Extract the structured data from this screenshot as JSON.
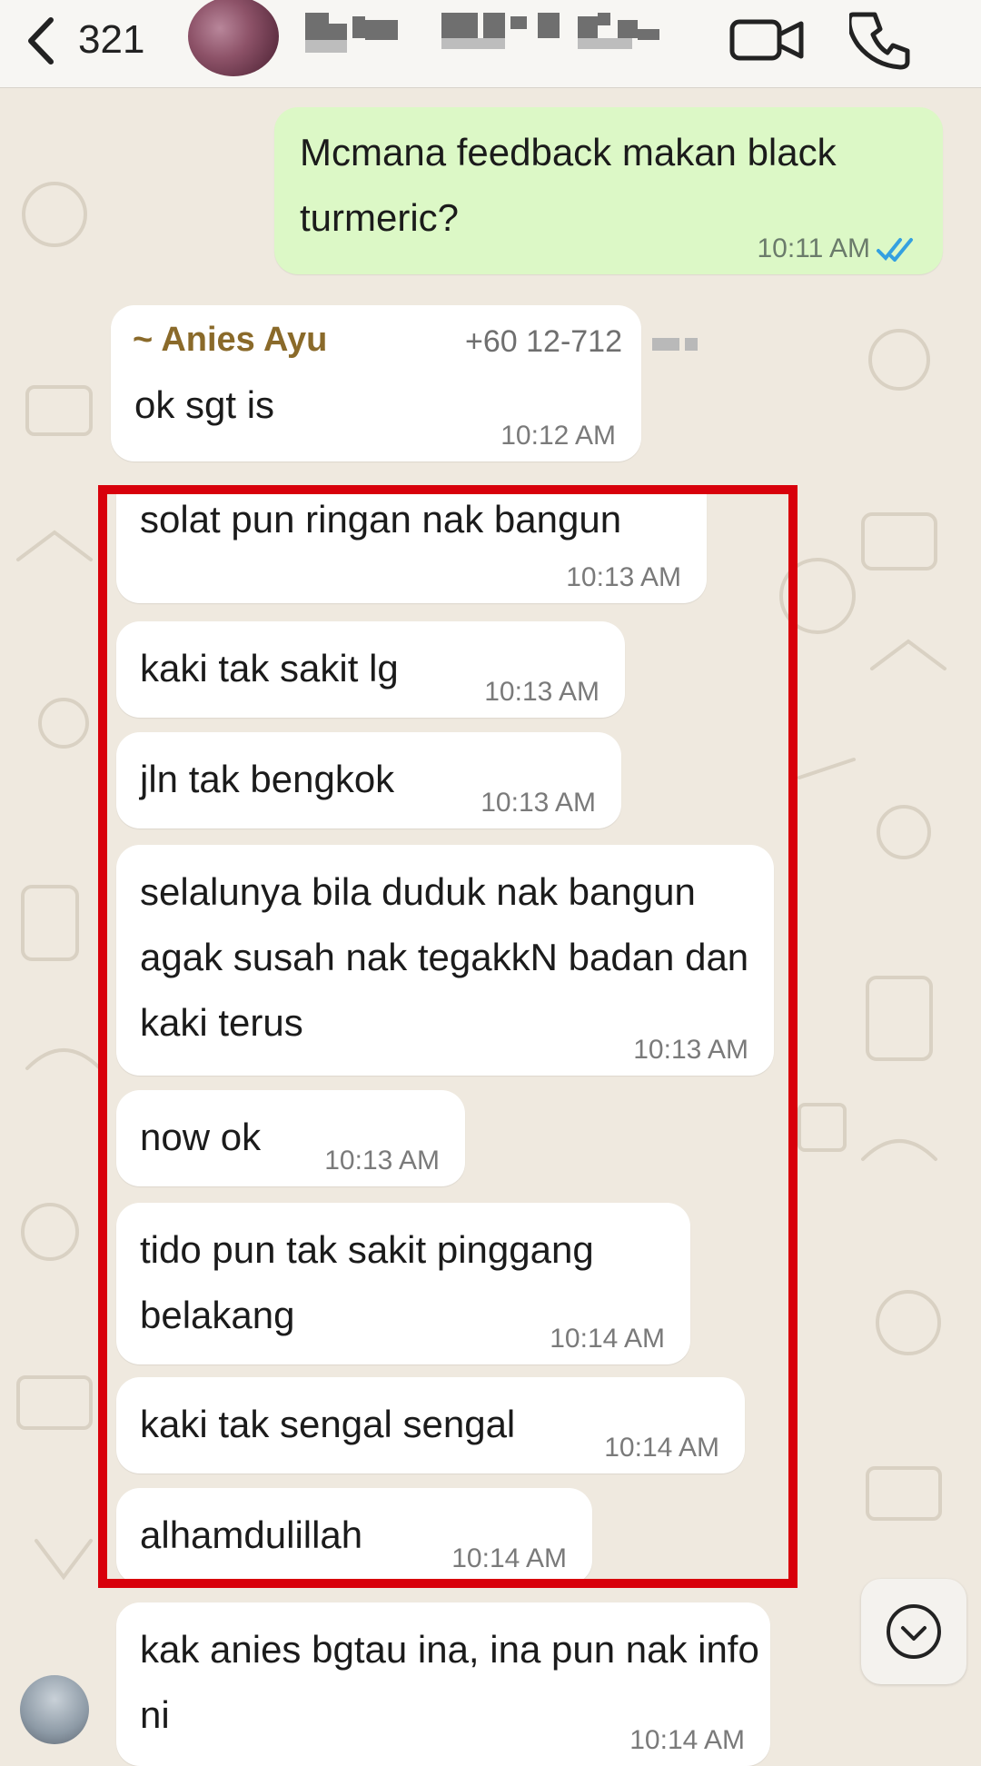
{
  "header": {
    "back_count": "321",
    "icons": [
      "chevron-left-icon",
      "video-camera-icon",
      "phone-icon"
    ]
  },
  "messages": [
    {
      "id": "m1",
      "direction": "outgoing",
      "text": "Mcmana feedback makan black turmeric?",
      "time": "10:11 AM",
      "status": "read"
    },
    {
      "id": "m2",
      "direction": "incoming",
      "sender": "~ Anies Ayu",
      "phone": "+60 12-712",
      "text": "ok sgt is",
      "time": "10:12 AM"
    },
    {
      "id": "m3",
      "direction": "incoming",
      "text": "solat pun ringan nak bangun",
      "time": "10:13 AM"
    },
    {
      "id": "m4",
      "direction": "incoming",
      "text": "kaki tak sakit lg",
      "time": "10:13 AM"
    },
    {
      "id": "m5",
      "direction": "incoming",
      "text": "jln tak bengkok",
      "time": "10:13 AM"
    },
    {
      "id": "m6",
      "direction": "incoming",
      "text": "selalunya bila duduk nak bangun agak susah nak tegakkN badan dan kaki terus",
      "time": "10:13 AM"
    },
    {
      "id": "m7",
      "direction": "incoming",
      "text": "now ok",
      "time": "10:13 AM"
    },
    {
      "id": "m8",
      "direction": "incoming",
      "text": "tido pun tak sakit pinggang belakang",
      "time": "10:14 AM"
    },
    {
      "id": "m9",
      "direction": "incoming",
      "text": "kaki tak sengal sengal",
      "time": "10:14 AM"
    },
    {
      "id": "m10",
      "direction": "incoming",
      "text": "alhamdulillah",
      "time": "10:14 AM"
    },
    {
      "id": "m11",
      "direction": "incoming",
      "text": "kak anies bgtau ina, ina pun nak info ni",
      "time": "10:14 AM"
    }
  ],
  "colors": {
    "highlight_border": "#d8000b",
    "outgoing_bubble": "#dcf8c6",
    "incoming_bubble": "#ffffff",
    "sender_name": "#8a6a2a",
    "read_ticks": "#34a0e0"
  }
}
